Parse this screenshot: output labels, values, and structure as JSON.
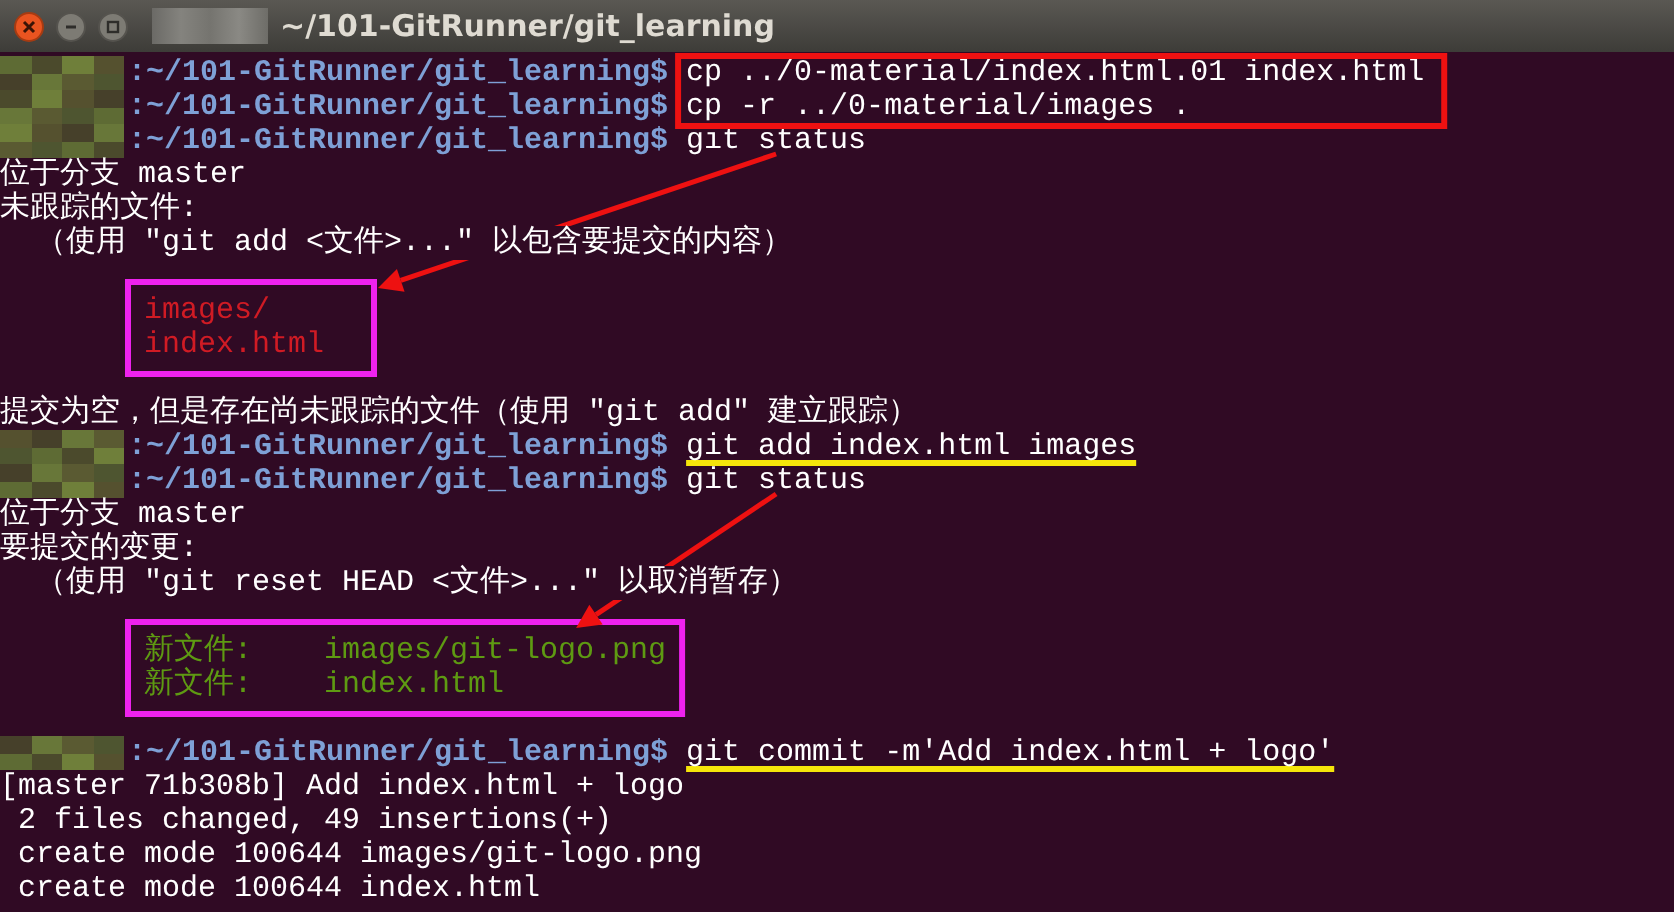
{
  "window": {
    "title": "~/101-GitRunner/git_learning"
  },
  "lines": [
    {
      "kind": "prompt",
      "path": ":~/101-GitRunner/git_learning$",
      "command": "cp ../0-material/index.html.01 index.html",
      "boxed": true
    },
    {
      "kind": "prompt",
      "path": ":~/101-GitRunner/git_learning$",
      "command": "cp -r ../0-material/images .",
      "boxed": true
    },
    {
      "kind": "prompt",
      "path": ":~/101-GitRunner/git_learning$",
      "command": "git status",
      "arrow": true
    },
    {
      "kind": "output",
      "text": "位于分支 master"
    },
    {
      "kind": "output",
      "text": "未跟踪的文件:"
    },
    {
      "kind": "output",
      "text": "  （使用 \"git add <文件>...\" 以包含要提交的内容）"
    },
    {
      "kind": "blank"
    },
    {
      "kind": "untracked",
      "text": "images/",
      "boxed": true
    },
    {
      "kind": "untracked",
      "text": "index.html",
      "boxed": true
    },
    {
      "kind": "blank"
    },
    {
      "kind": "output",
      "text": "提交为空，但是存在尚未跟踪的文件（使用 \"git add\" 建立跟踪）"
    },
    {
      "kind": "prompt",
      "path": ":~/101-GitRunner/git_learning$",
      "command": "git add index.html images",
      "underlined": true
    },
    {
      "kind": "prompt",
      "path": ":~/101-GitRunner/git_learning$",
      "command": "git status",
      "arrow": true
    },
    {
      "kind": "output",
      "text": "位于分支 master"
    },
    {
      "kind": "output",
      "text": "要提交的变更:"
    },
    {
      "kind": "output",
      "text": "  （使用 \"git reset HEAD <文件>...\" 以取消暂存）"
    },
    {
      "kind": "blank"
    },
    {
      "kind": "staged",
      "text": "新文件:    images/git-logo.png",
      "boxed": true
    },
    {
      "kind": "staged",
      "text": "新文件:    index.html",
      "boxed": true
    },
    {
      "kind": "blank"
    },
    {
      "kind": "prompt",
      "path": ":~/101-GitRunner/git_learning$",
      "command": "git commit -m'Add index.html + logo'",
      "underlined": true
    },
    {
      "kind": "output",
      "text": "[master 71b308b] Add index.html + logo"
    },
    {
      "kind": "output",
      "text": " 2 files changed, 49 insertions(+)"
    },
    {
      "kind": "output",
      "text": " create mode 100644 images/git-logo.png"
    },
    {
      "kind": "output",
      "text": " create mode 100644 index.html"
    }
  ]
}
